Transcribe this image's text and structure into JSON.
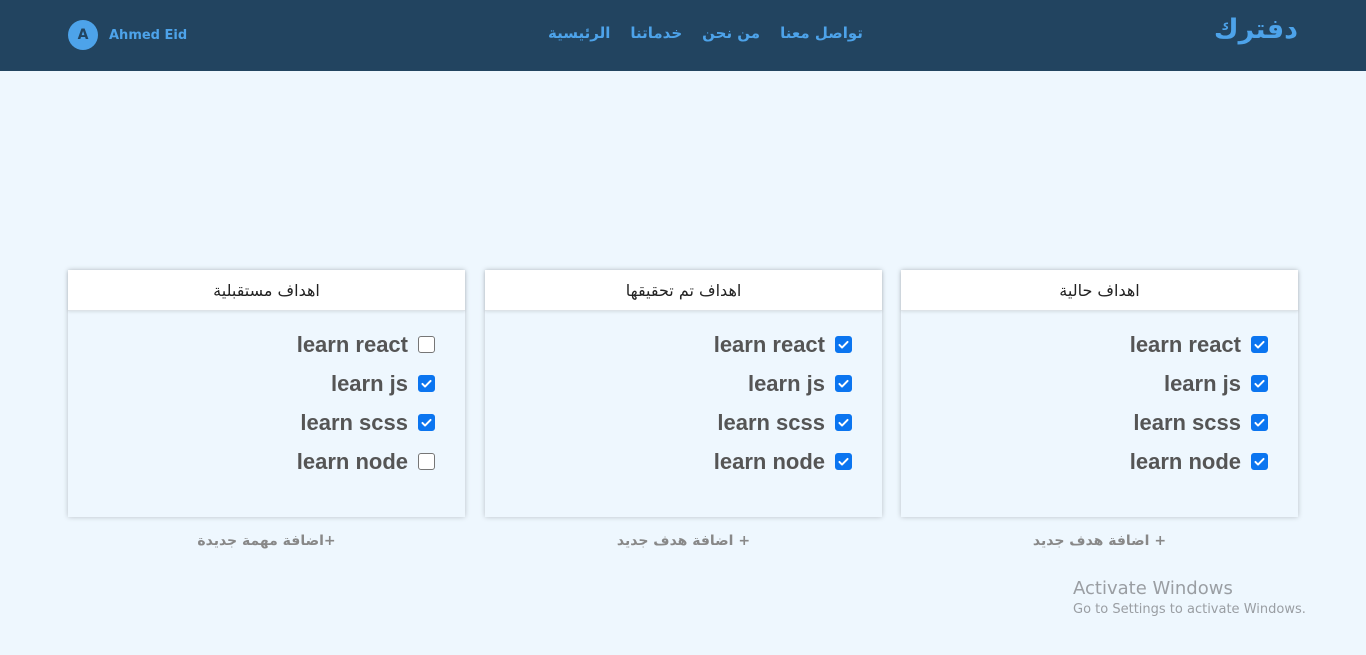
{
  "navbar": {
    "brand": "دفترك",
    "links": [
      "الرئيسية",
      "خدماتنا",
      "من نحن",
      "تواصل معنا"
    ],
    "user": {
      "initial": "A",
      "name": "Ahmed Eid"
    }
  },
  "boards": [
    {
      "title": "اهداف حالية",
      "items": [
        {
          "label": "learn react",
          "checked": true
        },
        {
          "label": "learn js",
          "checked": true
        },
        {
          "label": "learn scss",
          "checked": true
        },
        {
          "label": "learn node",
          "checked": true
        }
      ],
      "add_label": "+ اضافة هدف جديد"
    },
    {
      "title": "اهداف تم تحقيقها",
      "items": [
        {
          "label": "learn react",
          "checked": true
        },
        {
          "label": "learn js",
          "checked": true
        },
        {
          "label": "learn scss",
          "checked": true
        },
        {
          "label": "learn node",
          "checked": true
        }
      ],
      "add_label": "+ اضافة هدف جديد"
    },
    {
      "title": "اهداف مستقبلية",
      "items": [
        {
          "label": "learn react",
          "checked": false
        },
        {
          "label": "learn js",
          "checked": true
        },
        {
          "label": "learn scss",
          "checked": true
        },
        {
          "label": "learn node",
          "checked": false
        }
      ],
      "add_label": "+اضافة مهمة جديدة"
    }
  ],
  "watermark": {
    "title": "Activate Windows",
    "subtitle": "Go to Settings to activate Windows."
  },
  "colors": {
    "navbar_bg": "#224460",
    "accent": "#4da3ea",
    "page_bg": "#eef7fe",
    "checkbox": "#0b75f0"
  }
}
